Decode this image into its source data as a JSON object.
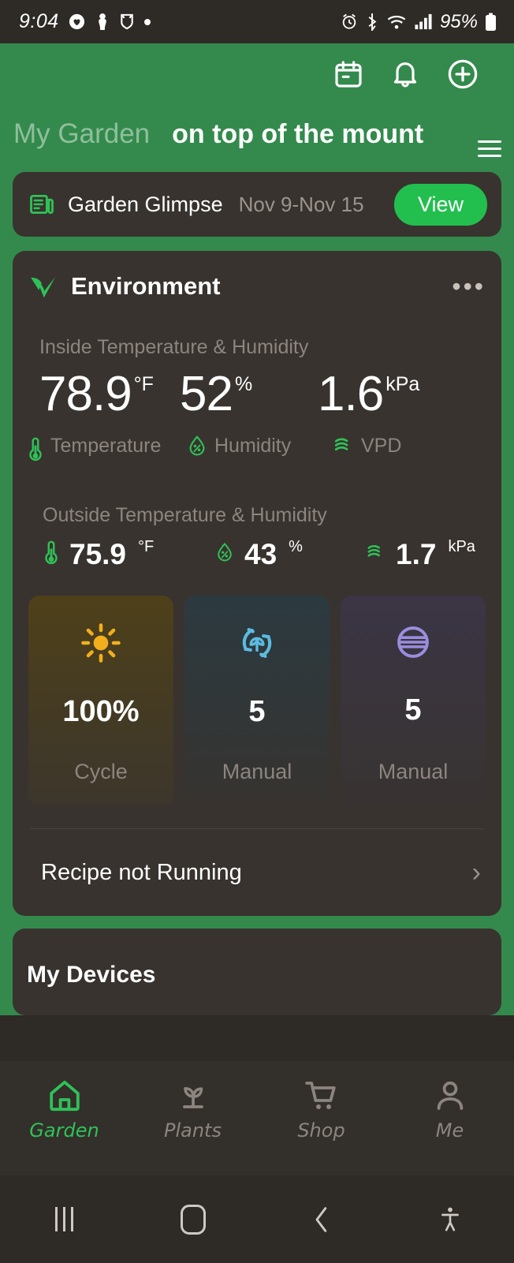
{
  "statusbar": {
    "time": "9:04",
    "battery": "95%",
    "left_icons": [
      "heart-circle-icon",
      "figure-icon",
      "shield-icon",
      "dot-icon"
    ],
    "right_icons": [
      "alarm-icon",
      "bluetooth-icon",
      "wifi-icon",
      "signal-icon",
      "battery-icon"
    ]
  },
  "header": {
    "background_color": "#338a4c",
    "tab_inactive": "My Garden",
    "tab_active": "on top of the mount",
    "actions": [
      "calendar-icon",
      "bell-icon",
      "plus-circle-icon"
    ],
    "menu": "hamburger-menu-icon"
  },
  "glimpse": {
    "icon": "newspaper-icon",
    "title": "Garden Glimpse",
    "date_range": "Nov 9-Nov 15",
    "button_label": "View",
    "button_color": "#22bf4f"
  },
  "environment": {
    "logo": "vivosun-v-logo",
    "title": "Environment",
    "menu_icon": "more-options-icon",
    "inside": {
      "label": "Inside Temperature & Humidity",
      "metrics": [
        {
          "value": "78.9",
          "unit": "°F",
          "name": "Temperature",
          "icon": "thermometer-icon"
        },
        {
          "value": "52",
          "unit": "%",
          "name": "Humidity",
          "icon": "humidity-droplet-icon"
        },
        {
          "value": "1.6",
          "unit": "kPa",
          "name": "VPD",
          "icon": "vpd-waves-icon"
        }
      ]
    },
    "outside": {
      "label": "Outside Temperature & Humidity",
      "metrics": [
        {
          "value": "75.9",
          "unit": "°F",
          "icon": "thermometer-icon"
        },
        {
          "value": "43",
          "unit": "%",
          "icon": "humidity-droplet-icon"
        },
        {
          "value": "1.7",
          "unit": "kPa",
          "icon": "vpd-waves-icon"
        }
      ]
    },
    "devices": [
      {
        "icon": "sun-icon",
        "icon_color": "#f2ae1c",
        "value": "100%",
        "mode": "Cycle"
      },
      {
        "icon": "circulation-fan-icon",
        "icon_color": "#5bbbe0",
        "value": "5",
        "mode": "Manual"
      },
      {
        "icon": "inline-fan-icon",
        "icon_color": "#9b8ede",
        "value": "5",
        "mode": "Manual"
      }
    ],
    "recipe_status": "Recipe not Running",
    "recipe_chevron": "chevron-right-icon"
  },
  "my_devices": {
    "title": "My Devices"
  },
  "bottom_nav": {
    "items": [
      {
        "label": "Garden",
        "icon": "home-icon",
        "active": true
      },
      {
        "label": "Plants",
        "icon": "sprout-icon",
        "active": false
      },
      {
        "label": "Shop",
        "icon": "cart-icon",
        "active": false
      },
      {
        "label": "Me",
        "icon": "person-icon",
        "active": false
      }
    ],
    "active_color": "#2fc257"
  },
  "android_nav": {
    "recents": "recents-icon",
    "home": "home-button-icon",
    "back": "back-icon",
    "accessibility": "accessibility-icon"
  }
}
